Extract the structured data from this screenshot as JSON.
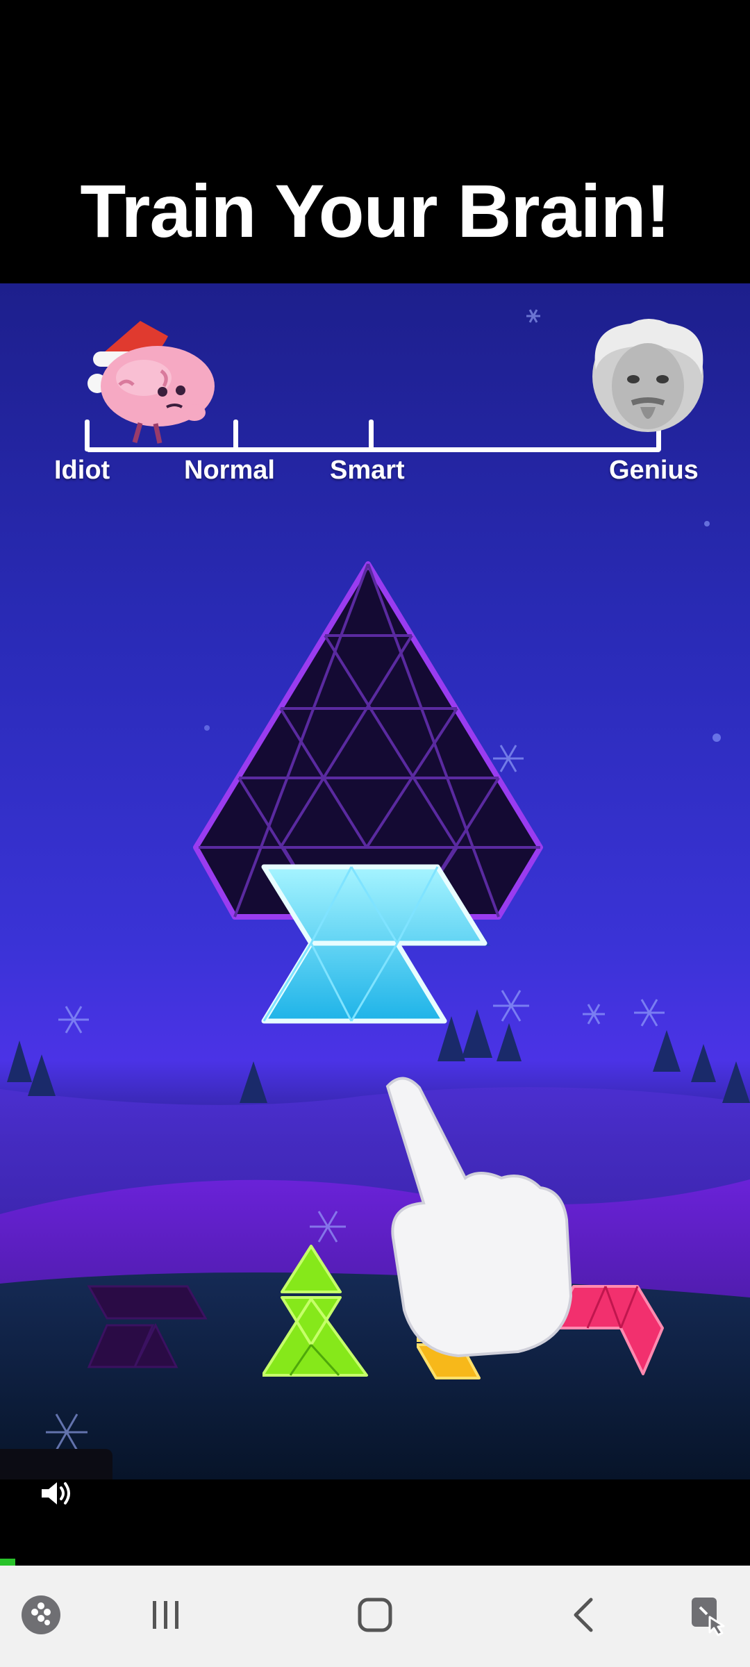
{
  "title": "Train Your Brain!",
  "scale": {
    "labels": [
      "Idiot",
      "Normal",
      "Smart",
      "Genius"
    ]
  },
  "icons": {
    "sound": "speaker-volume-icon",
    "nav": [
      "game-launcher-icon",
      "recent-apps-icon",
      "home-icon",
      "back-icon",
      "screen-assist-icon"
    ]
  },
  "colors": {
    "cyan_piece": "#35d2f5",
    "green_piece": "#86e81a",
    "yellow_piece": "#f7b81a",
    "pink_piece": "#f2306e",
    "ghost_piece": "#2a0b45",
    "board": "#12082e",
    "board_glow": "#8c34d9",
    "progress": "#29c32a"
  }
}
